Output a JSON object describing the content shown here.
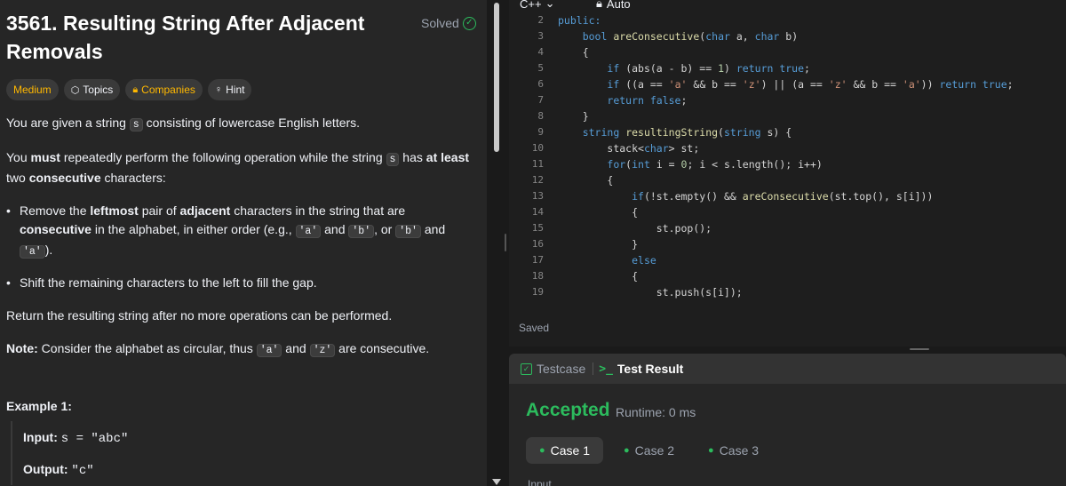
{
  "problem": {
    "title": "3561. Resulting String After Adjacent Removals",
    "solved_label": "Solved",
    "tags": {
      "difficulty": "Medium",
      "topics": "Topics",
      "companies": "Companies",
      "hint": "Hint"
    },
    "description": {
      "p1_a": "You are given a string ",
      "p1_code": "s",
      "p1_b": " consisting of lowercase English letters.",
      "p2_a": "You ",
      "p2_must": "must",
      "p2_b": " repeatedly perform the following operation while the string ",
      "p2_code": "s",
      "p2_c": " has ",
      "p2_atleast": "at least",
      "p2_d": " two ",
      "p2_consec": "consecutive",
      "p2_e": " characters:",
      "b1_a": "Remove the ",
      "b1_leftmost": "leftmost",
      "b1_b": " pair of ",
      "b1_adjacent": "adjacent",
      "b1_c": " characters in the string that are ",
      "b1_consec": "consecutive",
      "b1_d": " in the alphabet, in either order (e.g., ",
      "b1_code1": "'a'",
      "b1_and": " and ",
      "b1_code2": "'b'",
      "b1_or": ", or ",
      "b1_code3": "'b'",
      "b1_and2": " and ",
      "b1_code4": "'a'",
      "b1_end": ").",
      "b2": "Shift the remaining characters to the left to fill the gap.",
      "p3": "Return the resulting string after no more operations can be performed.",
      "note_label": "Note:",
      "note_a": " Consider the alphabet as circular, thus ",
      "note_code1": "'a'",
      "note_and": " and ",
      "note_code2": "'z'",
      "note_b": " are consecutive."
    },
    "example": {
      "title": "Example 1:",
      "input_label": "Input:",
      "input_value": "s = \"abc\"",
      "output_label": "Output:",
      "output_value": "\"c\""
    }
  },
  "editor": {
    "language": "C++",
    "autosave": "Auto",
    "saved_label": "Saved",
    "line_numbers": [
      "2",
      "3",
      "4",
      "5",
      "6",
      "7",
      "8",
      "9",
      "10",
      "11",
      "12",
      "13",
      "14",
      "15",
      "16",
      "17",
      "18",
      "19"
    ]
  },
  "results": {
    "tab_testcase": "Testcase",
    "tab_result": "Test Result",
    "status": "Accepted",
    "runtime": "Runtime: 0 ms",
    "cases": [
      "Case 1",
      "Case 2",
      "Case 3"
    ],
    "input_label": "Input"
  },
  "colors": {
    "accent_green": "#2cbb5d",
    "medium_yellow": "#ffb800",
    "panel_bg": "#262626",
    "editor_bg": "#1e1e1e"
  }
}
